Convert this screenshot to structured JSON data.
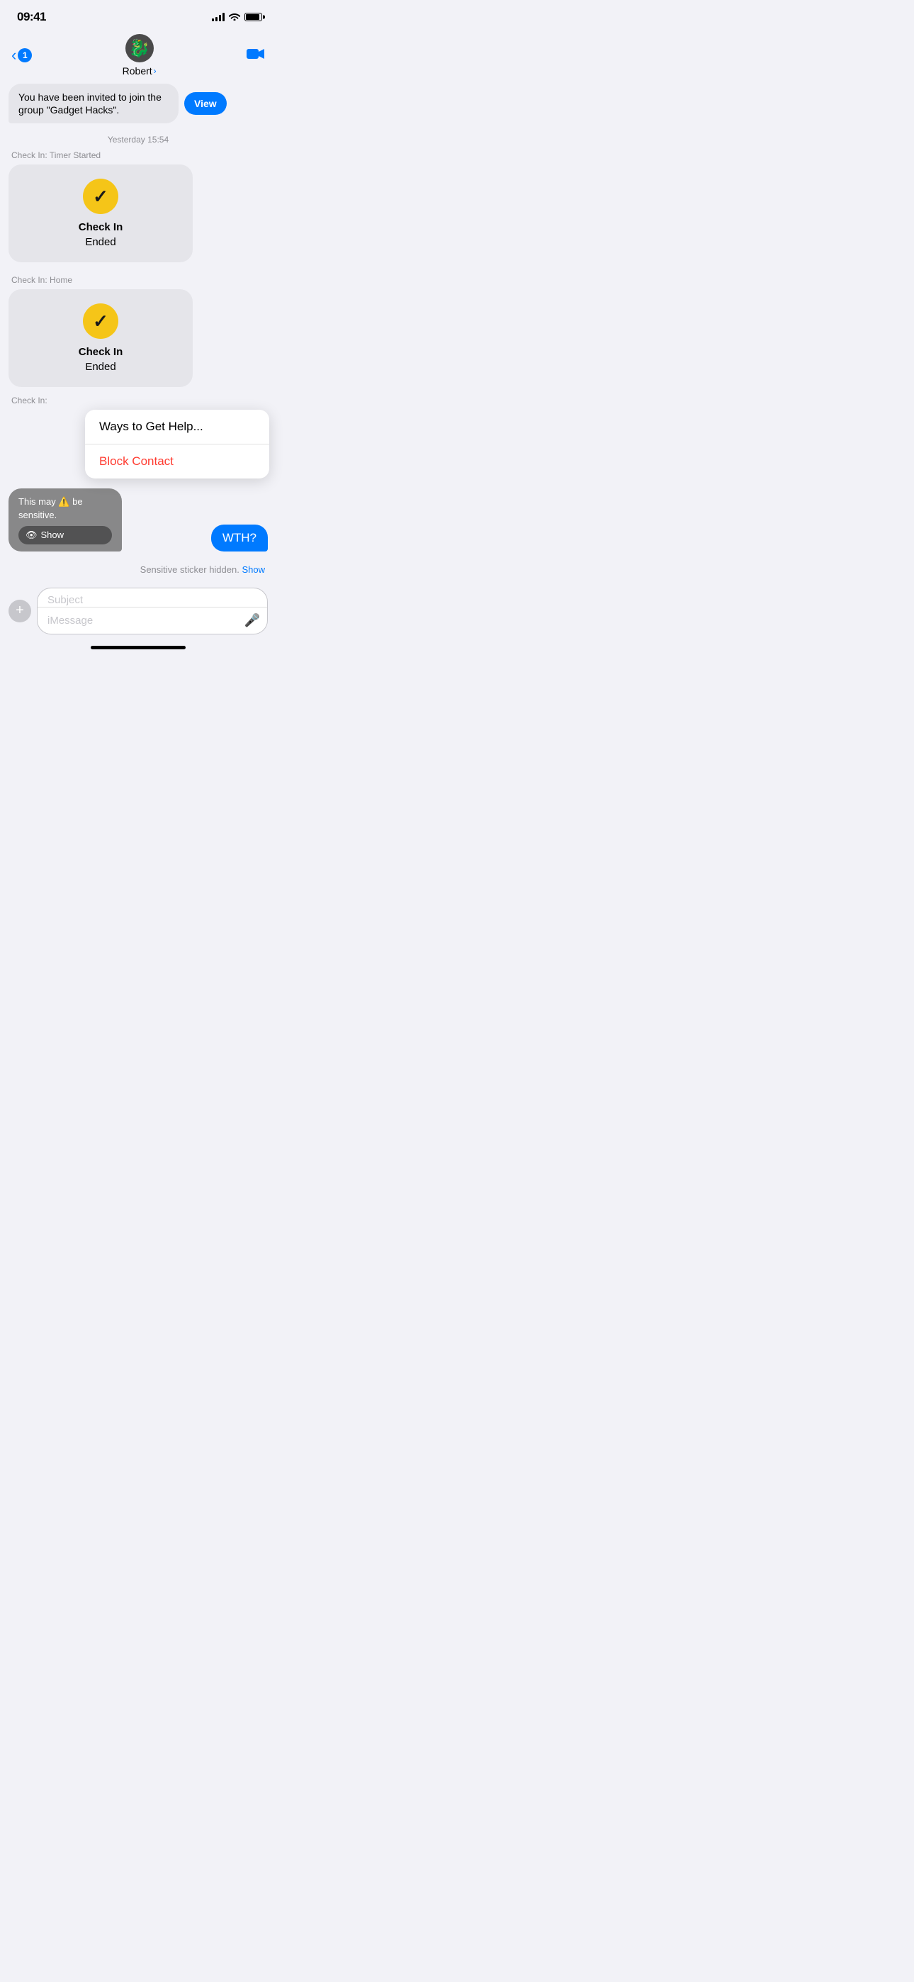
{
  "status_bar": {
    "time": "09:41",
    "signal_bars": 4,
    "icons": [
      "wifi",
      "battery"
    ]
  },
  "nav": {
    "back_label": "",
    "badge_count": "1",
    "contact_name": "Robert",
    "contact_chevron": "›",
    "video_icon": "📹"
  },
  "messages": {
    "invite_text": "You have been invited to join the group \"Gadget Hacks\".",
    "view_button": "View",
    "timestamp": "Yesterday 15:54",
    "checkin1": {
      "label": "Check In: Timer Started",
      "title": "Check In",
      "subtitle": "Ended"
    },
    "checkin2": {
      "label": "Check In: Home",
      "title": "Check In",
      "subtitle": "Ended"
    },
    "checkin3_label": "Check In:",
    "context_menu": {
      "item1": "Ways to Get Help...",
      "item2": "Block Contact"
    },
    "sensitive_bubble": {
      "text": "This may ⚠️ be sensitive.",
      "show_label": "Show"
    },
    "wth_text": "WTH?",
    "sensitive_notice_text": "Sensitive sticker hidden.",
    "sensitive_notice_link": "Show"
  },
  "input": {
    "plus_icon": "+",
    "subject_placeholder": "Subject",
    "message_placeholder": "iMessage",
    "mic_icon": "🎤"
  }
}
